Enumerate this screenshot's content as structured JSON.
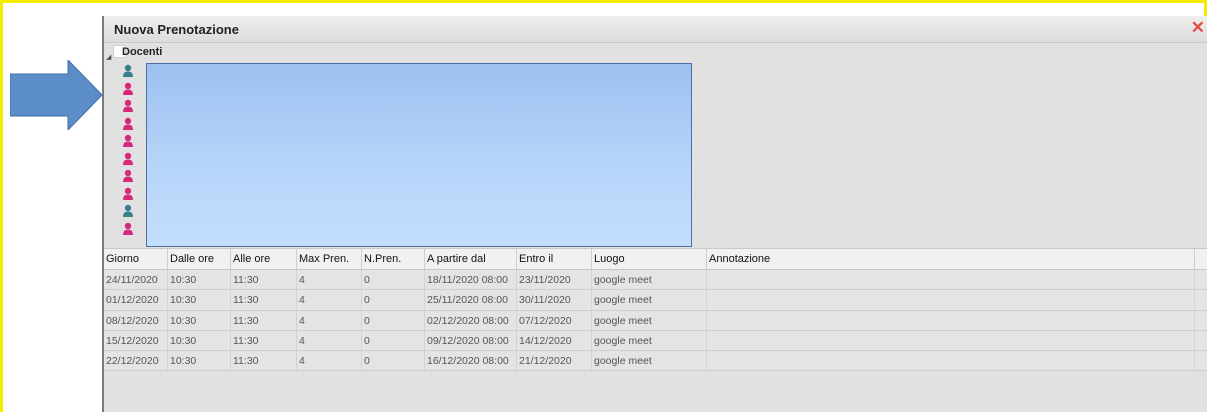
{
  "window": {
    "title": "Nuova Prenotazione",
    "close_icon": "close-icon"
  },
  "tree": {
    "root_label": "Docenti",
    "items": [
      {
        "icon": "teacher-male-icon",
        "color": "#3a7d8c"
      },
      {
        "icon": "teacher-female-icon",
        "color": "#d8287a"
      },
      {
        "icon": "teacher-female-icon",
        "color": "#d8287a"
      },
      {
        "icon": "teacher-female-icon",
        "color": "#d8287a"
      },
      {
        "icon": "teacher-female-icon",
        "color": "#d8287a"
      },
      {
        "icon": "teacher-female-icon",
        "color": "#d8287a"
      },
      {
        "icon": "teacher-female-icon",
        "color": "#d8287a"
      },
      {
        "icon": "teacher-female-icon",
        "color": "#d8287a"
      },
      {
        "icon": "teacher-male-icon",
        "color": "#3a7d8c"
      },
      {
        "icon": "teacher-female-icon",
        "color": "#d8287a"
      }
    ]
  },
  "table": {
    "headers": [
      "Giorno",
      "Dalle ore",
      "Alle ore",
      "Max Pren.",
      "N.Pren.",
      "A partire dal",
      "Entro il",
      "Luogo",
      "Annotazione",
      ""
    ],
    "rows": [
      [
        "24/11/2020",
        "10:30",
        "11:30",
        "4",
        "0",
        "18/11/2020 08:00",
        "23/11/2020",
        "google meet",
        "",
        ""
      ],
      [
        "01/12/2020",
        "10:30",
        "11:30",
        "4",
        "0",
        "25/11/2020 08:00",
        "30/11/2020",
        "google meet",
        "",
        ""
      ],
      [
        "08/12/2020",
        "10:30",
        "11:30",
        "4",
        "0",
        "02/12/2020 08:00",
        "07/12/2020",
        "google meet",
        "",
        ""
      ],
      [
        "15/12/2020",
        "10:30",
        "11:30",
        "4",
        "0",
        "09/12/2020 08:00",
        "14/12/2020",
        "google meet",
        "",
        ""
      ],
      [
        "22/12/2020",
        "10:30",
        "11:30",
        "4",
        "0",
        "16/12/2020 08:00",
        "21/12/2020",
        "google meet",
        "",
        ""
      ]
    ]
  },
  "colors": {
    "highlight_border": "#f5ec00",
    "arrow": "#5b8ec9",
    "selection_box": "#b8d6fb"
  }
}
